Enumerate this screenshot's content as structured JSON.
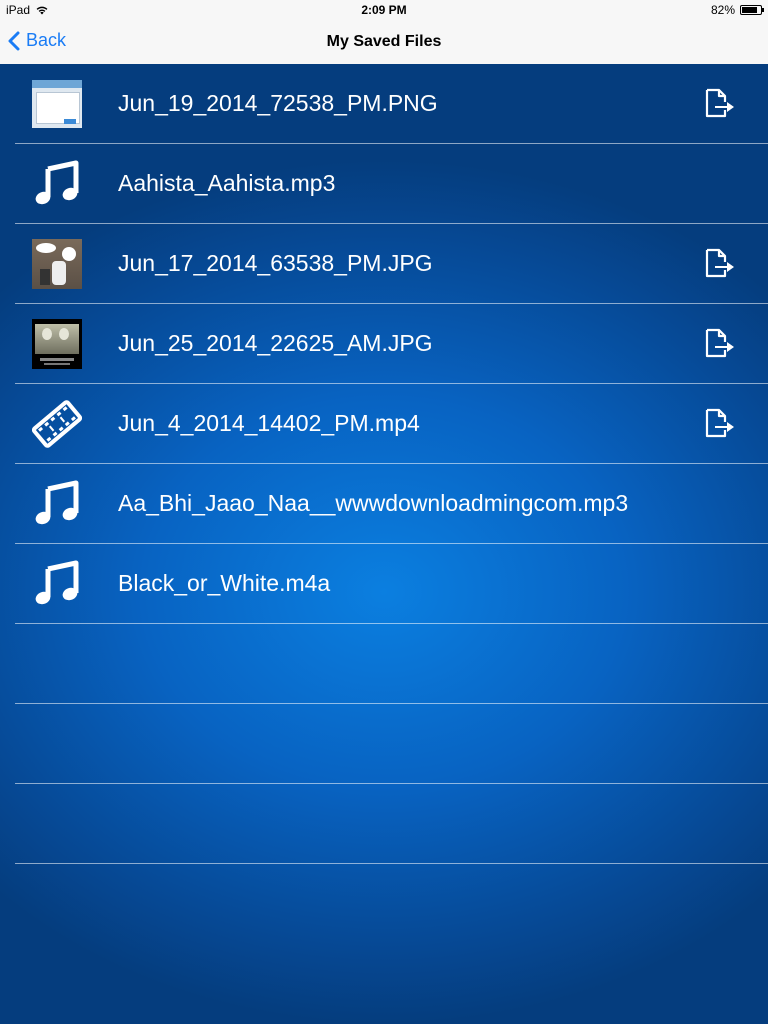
{
  "status_bar": {
    "device": "iPad",
    "time": "2:09 PM",
    "battery": "82%",
    "battery_level": 0.82
  },
  "nav_bar": {
    "back_label": "Back",
    "title": "My Saved Files",
    "accent_color": "#1a7cf5"
  },
  "files": [
    {
      "name": "Jun_19_2014_72538_PM.PNG",
      "icon": "image-thumbnail",
      "exportable": true
    },
    {
      "name": "Aahista_Aahista.mp3",
      "icon": "music-note-icon",
      "exportable": false
    },
    {
      "name": "Jun_17_2014_63538_PM.JPG",
      "icon": "image-thumbnail",
      "exportable": true
    },
    {
      "name": "Jun_25_2014_22625_AM.JPG",
      "icon": "image-thumbnail",
      "exportable": true
    },
    {
      "name": "Jun_4_2014_14402_PM.mp4",
      "icon": "film-strip-icon",
      "exportable": true
    },
    {
      "name": "Aa_Bhi_Jaao_Naa__wwwdownloadmingcom.mp3",
      "icon": "music-note-icon",
      "exportable": false
    },
    {
      "name": "Black_or_White.m4a",
      "icon": "music-note-icon",
      "exportable": false
    }
  ],
  "empty_rows": 3,
  "colors": {
    "background_center": "#0b7fe0",
    "background_edge": "#053d7e",
    "text": "#ffffff"
  }
}
